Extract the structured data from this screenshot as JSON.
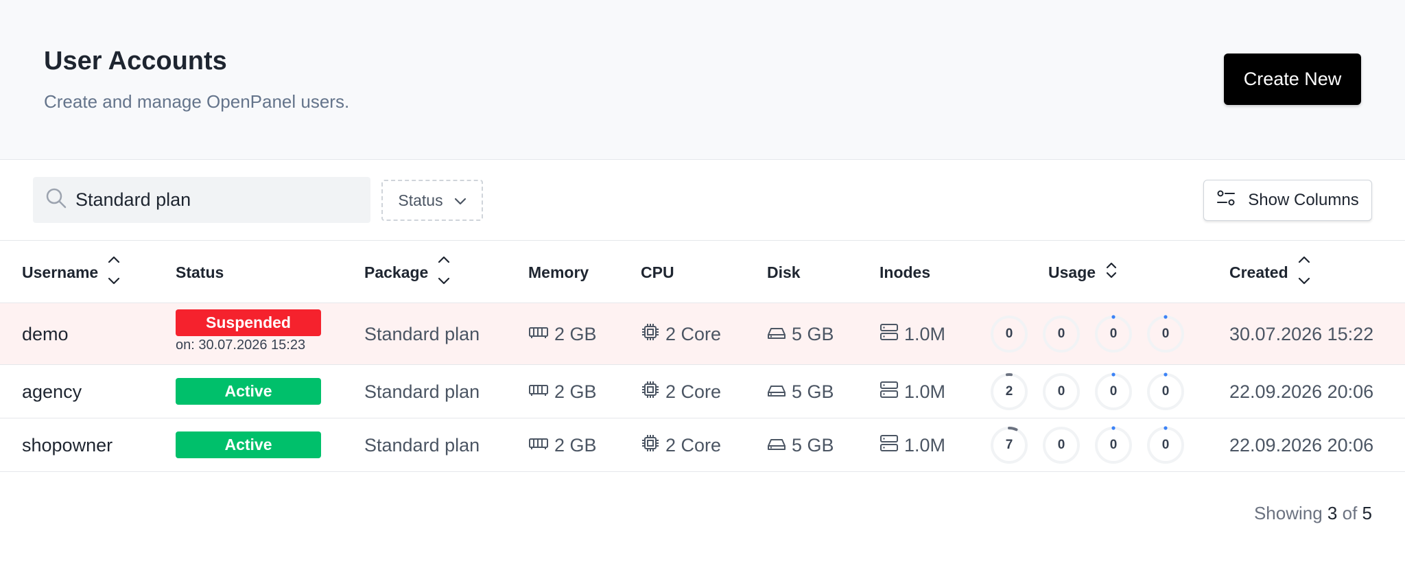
{
  "header": {
    "title": "User Accounts",
    "subtitle": "Create and manage OpenPanel users.",
    "create_label": "Create New"
  },
  "toolbar": {
    "search_value": "Standard plan",
    "status_filter_label": "Status",
    "show_columns_label": "Show Columns"
  },
  "columns": {
    "username": "Username",
    "status": "Status",
    "package": "Package",
    "memory": "Memory",
    "cpu": "CPU",
    "disk": "Disk",
    "inodes": "Inodes",
    "usage": "Usage",
    "created": "Created"
  },
  "rows": [
    {
      "username": "demo",
      "status": "Suspended",
      "status_since": "on: 30.07.2026 15:23",
      "package": "Standard plan",
      "memory": "2 GB",
      "cpu": "2 Core",
      "disk": "5 GB",
      "inodes": "1.0M",
      "usage": [
        "0",
        "0",
        "0",
        "0"
      ],
      "created": "30.07.2026 15:22"
    },
    {
      "username": "agency",
      "status": "Active",
      "package": "Standard plan",
      "memory": "2 GB",
      "cpu": "2 Core",
      "disk": "5 GB",
      "inodes": "1.0M",
      "usage": [
        "2",
        "0",
        "0",
        "0"
      ],
      "created": "22.09.2026 20:06"
    },
    {
      "username": "shopowner",
      "status": "Active",
      "package": "Standard plan",
      "memory": "2 GB",
      "cpu": "2 Core",
      "disk": "5 GB",
      "inodes": "1.0M",
      "usage": [
        "7",
        "0",
        "0",
        "0"
      ],
      "created": "22.09.2026 20:06"
    }
  ],
  "footer": {
    "showing": "Showing",
    "count": "3",
    "of": "of",
    "total": "5"
  },
  "colors": {
    "suspended": "#f5222d",
    "active": "#00c06b",
    "suspended_row_bg": "#fef2f2",
    "gauge_track": "#f1f3f5",
    "gauge_cpu": "#6b7280",
    "gauge_dot": "#3b82f6"
  },
  "icons": {
    "search": "search-icon",
    "dropdown": "chevron-down-icon",
    "columns": "sliders-icon",
    "sort": "sort-icon",
    "memory": "memory-icon",
    "cpu": "cpu-icon",
    "disk": "disk-icon",
    "inodes": "server-icon"
  }
}
